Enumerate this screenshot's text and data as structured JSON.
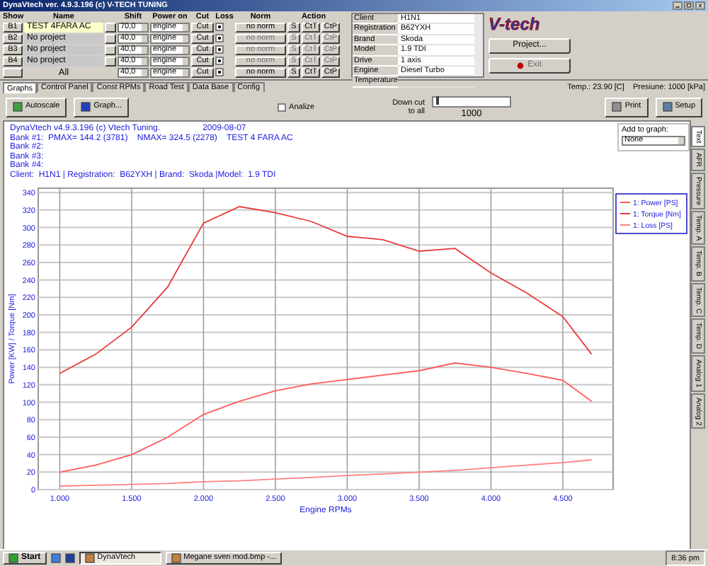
{
  "window": {
    "title": "DynaVtech ver. 4.9.3.196 (c) V-TECH TUNING"
  },
  "projects": {
    "columns": [
      "Show",
      "Name",
      "Shift",
      "Power on",
      "Cut",
      "Loss",
      "Norm",
      "Action"
    ],
    "rows": [
      {
        "show": "B1",
        "name": "TEST 4FARA AC",
        "selected": true,
        "disabled": false,
        "shift": "70,0",
        "power_on": "engine",
        "cut": "Cut",
        "loss": true,
        "norm": "no norm",
        "actions": [
          "S",
          "CtT",
          "CtP"
        ]
      },
      {
        "show": "B2",
        "name": "No project",
        "selected": false,
        "disabled": true,
        "shift": "40,0",
        "power_on": "engine",
        "cut": "Cut",
        "loss": true,
        "norm": "no norm",
        "actions": [
          "S",
          "CtT",
          "CtP"
        ]
      },
      {
        "show": "B3",
        "name": "No project",
        "selected": false,
        "disabled": true,
        "shift": "40,0",
        "power_on": "engine",
        "cut": "Cut",
        "loss": true,
        "norm": "no norm",
        "actions": [
          "S",
          "CtT",
          "CtP"
        ]
      },
      {
        "show": "B4",
        "name": "No project",
        "selected": false,
        "disabled": true,
        "shift": "40,0",
        "power_on": "engine",
        "cut": "Cut",
        "loss": true,
        "norm": "no norm",
        "actions": [
          "S",
          "CtT",
          "CtP"
        ]
      }
    ],
    "all": {
      "name": "All",
      "shift": "40,0",
      "power_on": "engine",
      "cut": "Cut",
      "loss": true,
      "norm": "no norm",
      "actions": [
        "S",
        "CtT",
        "CtP"
      ]
    }
  },
  "client": [
    {
      "label": "Client",
      "value": "H1N1"
    },
    {
      "label": "Registration",
      "value": "B62YXH"
    },
    {
      "label": "Brand",
      "value": "Skoda"
    },
    {
      "label": "Model",
      "value": "1.9 TDI"
    },
    {
      "label": "Drive",
      "value": "1 axis"
    },
    {
      "label": "Engine",
      "value": "Diesel Turbo"
    },
    {
      "label": "Temperature"
    }
  ],
  "logo": {
    "text": "V-tech"
  },
  "project_button": {
    "label": "Project..."
  },
  "exit_button": {
    "label": "Exit",
    "disabled": true
  },
  "tabs": [
    {
      "label": "Graphs",
      "selected": true
    },
    {
      "label": "Control Panel",
      "selected": false
    },
    {
      "label": "Const RPMs",
      "selected": false
    },
    {
      "label": "Road Test",
      "selected": false
    },
    {
      "label": "Data Base",
      "selected": false
    },
    {
      "label": "Config",
      "selected": false
    }
  ],
  "status": {
    "temperature": "Temp.: 23.90 [C]",
    "pressure": "Presiune: 1000 [kPa]"
  },
  "toolbar": {
    "autoscale": "Autoscale",
    "graph": "Graph...",
    "analize": {
      "label": "Analize",
      "checked": false
    },
    "down_cut": {
      "label": "Down cut",
      "label_2": "to all",
      "value": "1000",
      "level": 0.03
    },
    "print": "Print",
    "setup": "Setup"
  },
  "report": [
    {
      "text": "DynaVtech v4.9.3.196 (c) Vtech Tuning.",
      "date": "2009-08-07"
    },
    {
      "text": "Bank #1:  PMAX= 144.2 (3781)    NMAX= 324.5 (2278)    TEST 4 FARA AC"
    },
    {
      "text": "Bank #2:"
    },
    {
      "text": "Bank #3:"
    },
    {
      "text": "Bank #4:"
    },
    {
      "text": "Client:  H1N1 | Registration:  B62YXH | Brand:  Skoda |Model:  1.9 TDI"
    }
  ],
  "add_to_graph": {
    "label": "Add to graph:",
    "value": "None"
  },
  "chart_data": {
    "type": "line",
    "xlabel": "Engine RPMs",
    "ylabel": "Power [KW] / Torque [Nm]",
    "x": [
      1000,
      1250,
      1500,
      1750,
      2000,
      2250,
      2500,
      2750,
      3000,
      3250,
      3500,
      3750,
      4000,
      4250,
      4500,
      4700
    ],
    "series": [
      {
        "name": "1: Power [PS]",
        "color": "#ff5a5a",
        "values": [
          20,
          28,
          40,
          60,
          86,
          101,
          113,
          121,
          126,
          131,
          136,
          145,
          140,
          133,
          125,
          101
        ]
      },
      {
        "name": "1: Torque [Nm]",
        "color": "#e83a3a",
        "values": [
          133,
          155,
          186,
          232,
          305,
          324,
          317,
          307,
          290,
          286,
          273,
          276,
          248,
          225,
          198,
          155
        ]
      },
      {
        "name": "1: Loss [PS]",
        "color": "#ff8080",
        "values": [
          4,
          5,
          6,
          7,
          9,
          10,
          12,
          14,
          16,
          18,
          20,
          22,
          25,
          28,
          31,
          34
        ]
      }
    ],
    "grid": true,
    "legend": true,
    "xlim": [
      850,
      4850
    ],
    "ylim": [
      0,
      345
    ],
    "xticks": [
      {
        "value": 1000,
        "label": "1.000"
      },
      {
        "value": 1500,
        "label": "1.500"
      },
      {
        "value": 2000,
        "label": "2.000"
      },
      {
        "value": 2500,
        "label": "2.500"
      },
      {
        "value": 3000,
        "label": "3.000"
      },
      {
        "value": 3500,
        "label": "3.500"
      },
      {
        "value": 4000,
        "label": "4.000"
      },
      {
        "value": 4500,
        "label": "4.500"
      }
    ],
    "yticks": [
      0,
      20,
      40,
      60,
      80,
      100,
      120,
      140,
      160,
      180,
      200,
      220,
      240,
      260,
      280,
      300,
      320,
      340
    ]
  },
  "side_tabs": [
    {
      "label": "Text",
      "selected": true
    },
    {
      "label": "AFR",
      "selected": false
    },
    {
      "label": "Pressure",
      "selected": false
    },
    {
      "label": "Temp. A",
      "selected": false
    },
    {
      "label": "Temp. B",
      "selected": false
    },
    {
      "label": "Temp. C",
      "selected": false
    },
    {
      "label": "Temp. D",
      "selected": false
    },
    {
      "label": "Analog 1",
      "selected": false
    },
    {
      "label": "Analog 2",
      "selected": false
    }
  ],
  "taskbar": {
    "start": "Start",
    "tasks": [
      {
        "label": "DynaVtech",
        "selected": true
      },
      {
        "label": "Megane sven mod.bmp -...",
        "selected": false
      }
    ],
    "clock": "8:36 pm"
  }
}
